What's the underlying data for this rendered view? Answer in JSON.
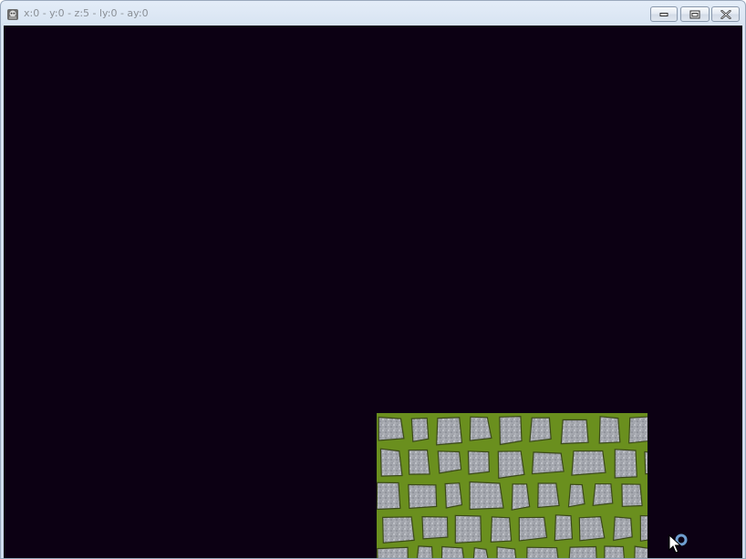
{
  "window": {
    "title": "x:0 - y:0 - z:5 - ly:0 - ay:0",
    "app_icon": "app-icon",
    "buttons": {
      "minimize_icon": "minimize-icon",
      "maximize_icon": "restore-icon",
      "close_icon": "close-icon"
    }
  },
  "viewport": {
    "background_color": "#0c0013",
    "tile": {
      "texture": "cobblestone-moss"
    }
  },
  "cursor": {
    "state": "busy"
  }
}
